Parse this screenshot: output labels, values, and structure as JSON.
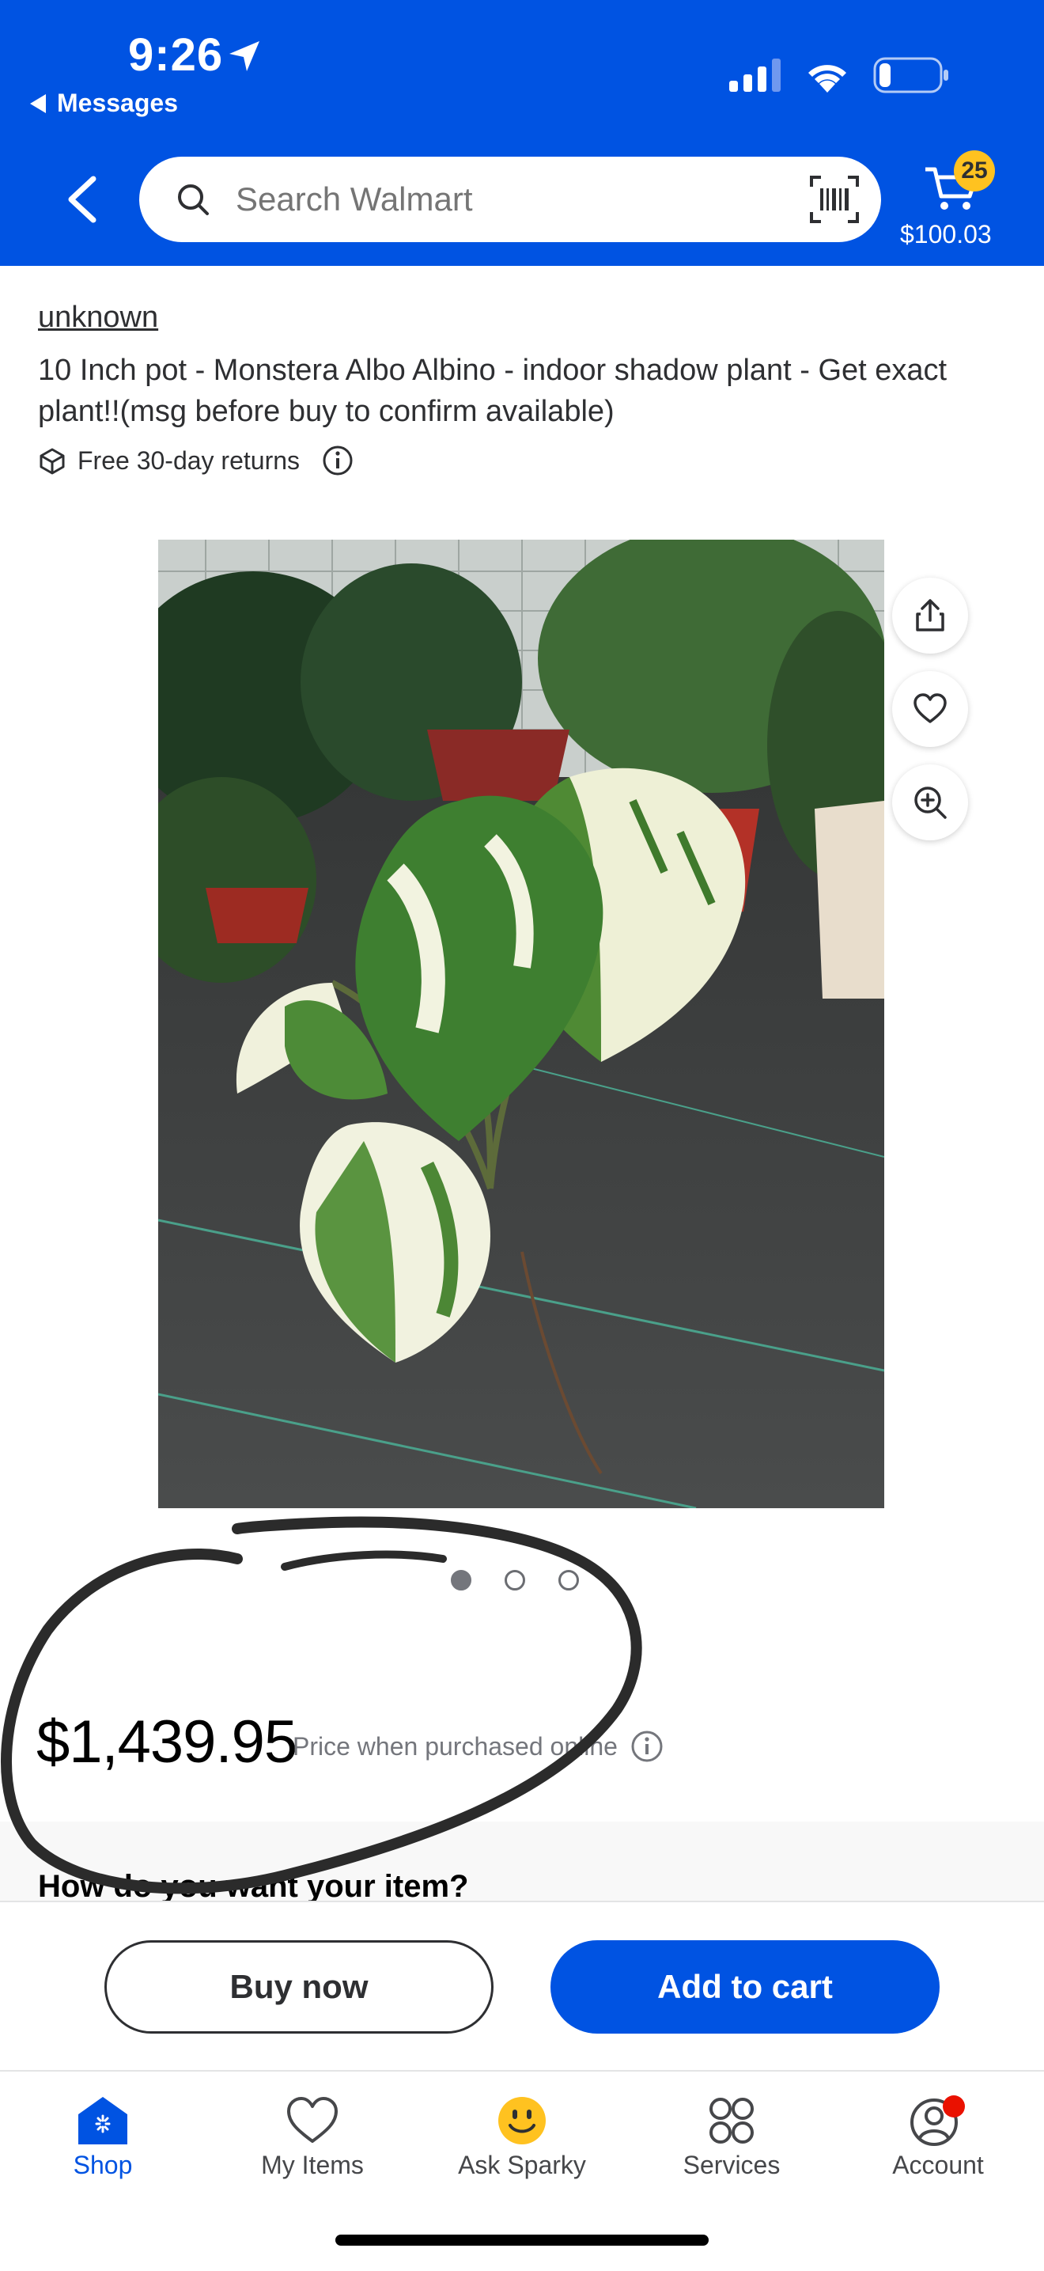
{
  "status_bar": {
    "time": "9:26",
    "back_app": "Messages"
  },
  "search": {
    "placeholder": "Search Walmart"
  },
  "cart": {
    "count": "25",
    "total": "$100.03"
  },
  "product": {
    "seller": "unknown",
    "title": "10 Inch pot - Monstera Albo Albino - indoor shadow plant - Get exact plant!!(msg before buy to confirm available)",
    "returns": "Free 30-day returns",
    "price": "$1,439.95",
    "price_note": "Price when purchased online",
    "images_total": 3,
    "images_active": 1
  },
  "fulfillment": {
    "title": "How do you want your item?"
  },
  "actions": {
    "buy_now": "Buy now",
    "add_to_cart": "Add to cart"
  },
  "tabs": [
    {
      "label": "Shop",
      "icon": "store-icon",
      "active": true
    },
    {
      "label": "My Items",
      "icon": "heart-icon",
      "active": false
    },
    {
      "label": "Ask Sparky",
      "icon": "sparky-icon",
      "active": false
    },
    {
      "label": "Services",
      "icon": "services-icon",
      "active": false
    },
    {
      "label": "Account",
      "icon": "account-icon",
      "active": false
    }
  ],
  "colors": {
    "brand_blue": "#0053e2",
    "badge_yellow": "#ffc220",
    "notification_red": "#ea1100"
  }
}
